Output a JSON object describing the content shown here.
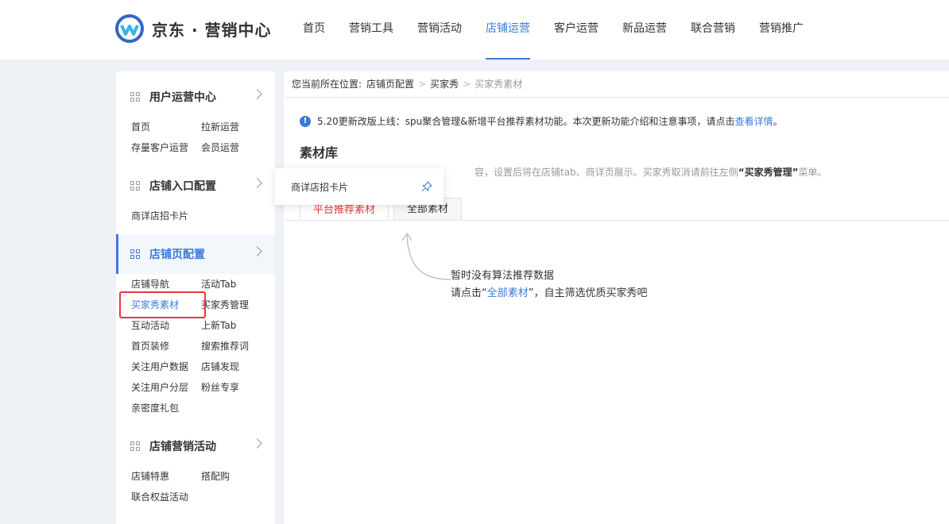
{
  "brand": {
    "name": "京东 · 营销中心"
  },
  "nav": [
    {
      "label": "首页"
    },
    {
      "label": "营销工具"
    },
    {
      "label": "营销活动"
    },
    {
      "label": "店铺运营",
      "active": true
    },
    {
      "label": "客户运营"
    },
    {
      "label": "新品运营"
    },
    {
      "label": "联合营销"
    },
    {
      "label": "营销推广"
    }
  ],
  "sidebar": {
    "groups": [
      {
        "title": "用户运营中心",
        "items": [
          "首页",
          "拉新运营",
          "存量客户运营",
          "会员运营"
        ]
      },
      {
        "title": "店铺入口配置",
        "items": [
          "商详店招卡片"
        ]
      },
      {
        "title": "店铺页配置",
        "active": true,
        "items": [
          "店铺导航",
          "活动Tab",
          "买家秀素材",
          "买家秀管理",
          "互动活动",
          "上新Tab",
          "首页装修",
          "搜索推荐词",
          "关注用户数据",
          "店铺发现",
          "关注用户分层",
          "粉丝专享",
          "亲密度礼包"
        ]
      },
      {
        "title": "店铺营销活动",
        "items": [
          "店铺特惠",
          "搭配购",
          "联合权益活动"
        ]
      }
    ],
    "active_item": "买家秀素材"
  },
  "popover": {
    "label": "商详店招卡片",
    "icon": "pin-icon"
  },
  "breadcrumb": {
    "prefix": "您当前所在位置:",
    "items": [
      "店铺页配置",
      "买家秀",
      "买家秀素材"
    ]
  },
  "notice": {
    "text": "5.20更新改版上线：spu聚合管理&新增平台推荐素材功能。本次更新功能介绍和注意事项，请点击",
    "link": "查看详情",
    "end": "。"
  },
  "section": {
    "title": "素材库",
    "desc_pre": "容，设置后将在店铺tab、商详页展示。买家秀取消请前往左侧",
    "desc_bold": "“买家秀管理”",
    "desc_post": "菜单。"
  },
  "tabs": [
    {
      "label": "平台推荐素材",
      "active": true
    },
    {
      "label": "全部素材"
    }
  ],
  "empty": {
    "line1": "暂时没有算法推荐数据",
    "line2_pre": "请点击“",
    "line2_link": "全部素材",
    "line2_post": "”，自主筛选优质买家秀吧"
  },
  "colors": {
    "accent": "#3b7ad9",
    "red": "#e4393c"
  }
}
